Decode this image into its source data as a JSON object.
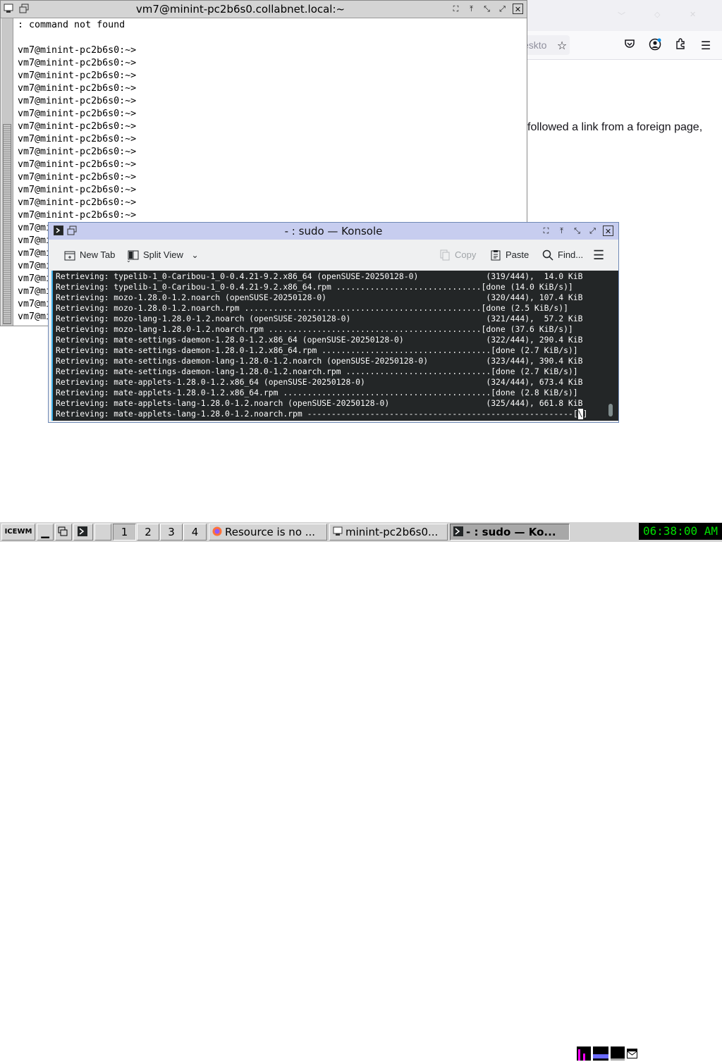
{
  "firefox": {
    "url_fragment": "eskto",
    "page_text": "followed a link from a foreign page,",
    "icons": [
      "bookmark-star-icon",
      "pocket-icon",
      "account-icon",
      "extensions-icon",
      "menu-icon"
    ]
  },
  "xterm": {
    "title": "vm7@minint-pc2b6s0.collabnet.local:~",
    "lines": [
      ": command not found",
      "",
      "vm7@minint-pc2b6s0:~>",
      "vm7@minint-pc2b6s0:~>",
      "vm7@minint-pc2b6s0:~>",
      "vm7@minint-pc2b6s0:~>",
      "vm7@minint-pc2b6s0:~>",
      "vm7@minint-pc2b6s0:~>",
      "vm7@minint-pc2b6s0:~>",
      "vm7@minint-pc2b6s0:~>",
      "vm7@minint-pc2b6s0:~>",
      "vm7@minint-pc2b6s0:~>",
      "vm7@minint-pc2b6s0:~>",
      "vm7@minint-pc2b6s0:~>",
      "vm7@minint-pc2b6s0:~>",
      "vm7@minint-pc2b6s0:~>",
      "vm7@minint-pc2b6s0:~>",
      "vm7@minint-pc2b6s0:~>",
      "vm7@minint-pc2b6s0:~>",
      "vm7@minint-pc2b6s0:~>",
      "vm7@minint-pc2b6s0:~>",
      "vm7@minint-pc2b6s0:~>",
      "vm7@minint-pc2b6s0:~>",
      "vm7@minint-pc2b6s0:~>",
      "vm7@minint-pc2b6s0:~>"
    ]
  },
  "konsole": {
    "title": "- : sudo — Konsole",
    "toolbar": {
      "new_tab": "New Tab",
      "split_view": "Split View",
      "copy": "Copy",
      "paste": "Paste",
      "find": "Find..."
    },
    "lines": [
      "Retrieving: typelib-1_0-Caribou-1_0-0.4.21-9.2.x86_64 (openSUSE-20250128-0)              (319/444),  14.0 KiB",
      "Retrieving: typelib-1_0-Caribou-1_0-0.4.21-9.2.x86_64.rpm ..............................[done (14.0 KiB/s)]",
      "Retrieving: mozo-1.28.0-1.2.noarch (openSUSE-20250128-0)                                 (320/444), 107.4 KiB",
      "Retrieving: mozo-1.28.0-1.2.noarch.rpm .................................................[done (2.5 KiB/s)]",
      "Retrieving: mozo-lang-1.28.0-1.2.noarch (openSUSE-20250128-0)                            (321/444),  57.2 KiB",
      "Retrieving: mozo-lang-1.28.0-1.2.noarch.rpm ............................................[done (37.6 KiB/s)]",
      "Retrieving: mate-settings-daemon-1.28.0-1.2.x86_64 (openSUSE-20250128-0)                 (322/444), 290.4 KiB",
      "Retrieving: mate-settings-daemon-1.28.0-1.2.x86_64.rpm ...................................[done (2.7 KiB/s)]",
      "Retrieving: mate-settings-daemon-lang-1.28.0-1.2.noarch (openSUSE-20250128-0)            (323/444), 390.4 KiB",
      "Retrieving: mate-settings-daemon-lang-1.28.0-1.2.noarch.rpm ..............................[done (2.7 KiB/s)]",
      "Retrieving: mate-applets-1.28.0-1.2.x86_64 (openSUSE-20250128-0)                         (324/444), 673.4 KiB",
      "Retrieving: mate-applets-1.28.0-1.2.x86_64.rpm ...........................................[done (2.8 KiB/s)]",
      "Retrieving: mate-applets-lang-1.28.0-1.2.noarch (openSUSE-20250128-0)                    (325/444), 661.8 KiB"
    ],
    "last_line": "Retrieving: mate-applets-lang-1.28.0-1.2.noarch.rpm -------------------------------------------------------[",
    "cursor_char": "\\",
    "last_line_end": "]"
  },
  "taskbar": {
    "start_label": "ICEWM",
    "workspaces": [
      "1",
      "2",
      "3",
      "4"
    ],
    "tasks": [
      {
        "label": "Resource is no ...",
        "icon": "firefox-icon"
      },
      {
        "label": "minint-pc2b6s0...",
        "icon": "xterm-icon"
      },
      {
        "label": "- : sudo — Ko...",
        "icon": "konsole-icon"
      }
    ],
    "clock": "06:38:00 AM"
  }
}
